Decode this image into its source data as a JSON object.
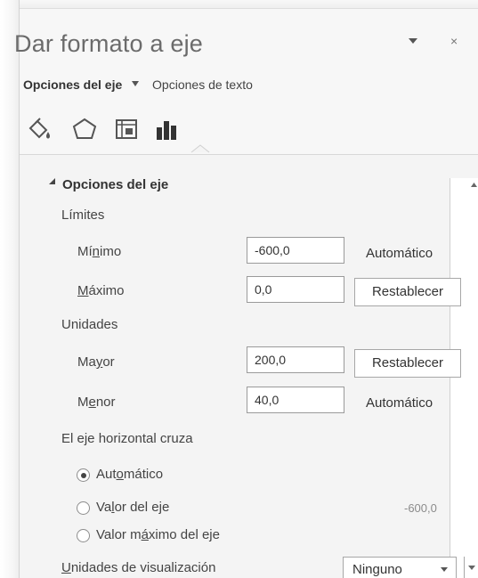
{
  "window": {
    "title": "Dar formato a eje",
    "close_glyph": "×"
  },
  "tabs": {
    "axis_options": "Opciones del eje",
    "text_options": "Opciones de texto"
  },
  "section": {
    "title": "Opciones del eje"
  },
  "bounds": {
    "heading": "Límites",
    "minimum": {
      "label_before": "Mí",
      "label_underline": "n",
      "label_after": "imo",
      "value": "-600,0",
      "state_text": "Automático"
    },
    "maximum": {
      "label_before": "",
      "label_underline": "M",
      "label_after": "áximo",
      "value": "0,0",
      "action_label": "Restablecer"
    }
  },
  "units": {
    "heading": "Unidades",
    "major": {
      "label_before": "Ma",
      "label_underline": "y",
      "label_after": "or",
      "value": "200,0",
      "action_label": "Restablecer"
    },
    "minor": {
      "label_before": "M",
      "label_underline": "e",
      "label_after": "nor",
      "value": "40,0",
      "state_text": "Automático"
    }
  },
  "horizontal_cross": {
    "heading": "El eje horizontal cruza",
    "options": [
      {
        "label_before": "Aut",
        "label_underline": "o",
        "label_after": "mático",
        "selected": true
      },
      {
        "label_before": "Va",
        "label_underline": "l",
        "label_after": "or del eje",
        "selected": false
      },
      {
        "label_before": "Valor m",
        "label_underline": "á",
        "label_after": "ximo del eje",
        "selected": false
      }
    ],
    "axis_value": "-600,0"
  },
  "display_units": {
    "label_underline": "U",
    "label_after": "nidades de visualización",
    "value": "Ninguno"
  },
  "icons": [
    "fill-line-icon",
    "effects-icon",
    "size-properties-icon",
    "axis-options-icon"
  ]
}
